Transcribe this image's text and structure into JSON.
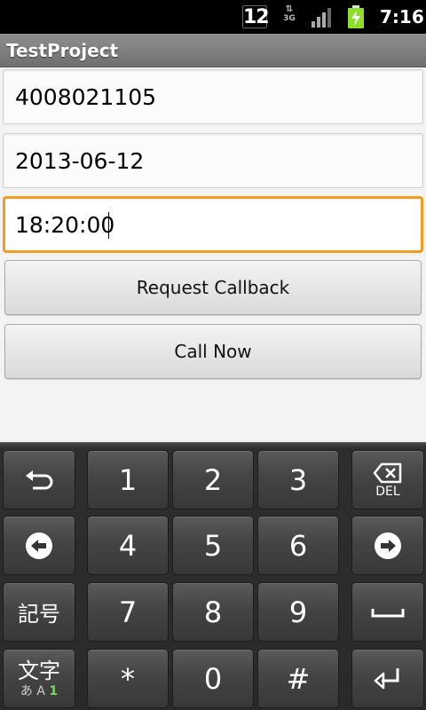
{
  "status_bar": {
    "notification_number": "12",
    "network_type": "3G",
    "time": "7:16",
    "icons": [
      "notification-count-icon",
      "data-arrows-icon",
      "signal-icon",
      "battery-charging-icon"
    ]
  },
  "title_bar": {
    "title": "TestProject"
  },
  "form": {
    "phone": {
      "value": "4008021105",
      "placeholder": ""
    },
    "date": {
      "value": "2013-06-12",
      "placeholder": ""
    },
    "time": {
      "value": "18:20:00",
      "placeholder": ""
    }
  },
  "buttons": {
    "request_callback": "Request Callback",
    "call_now": "Call Now"
  },
  "keyboard": {
    "digits": [
      "1",
      "2",
      "3",
      "4",
      "5",
      "6",
      "7",
      "8",
      "9",
      "*",
      "0",
      "#"
    ],
    "del_label": "DEL",
    "symbols_label": "記号",
    "mode_label": "文字",
    "mode_sub": "あ A",
    "mode_sub_num": "1",
    "icons": [
      "undo-icon",
      "backspace-icon",
      "left-arrow-icon",
      "right-arrow-icon",
      "space-icon",
      "enter-icon"
    ]
  },
  "colors": {
    "focus_accent": "#f39c1e",
    "title_bar": "#7f7f7f",
    "keyboard_bg": "#2a2a2a",
    "battery_green": "#8dde2a"
  }
}
